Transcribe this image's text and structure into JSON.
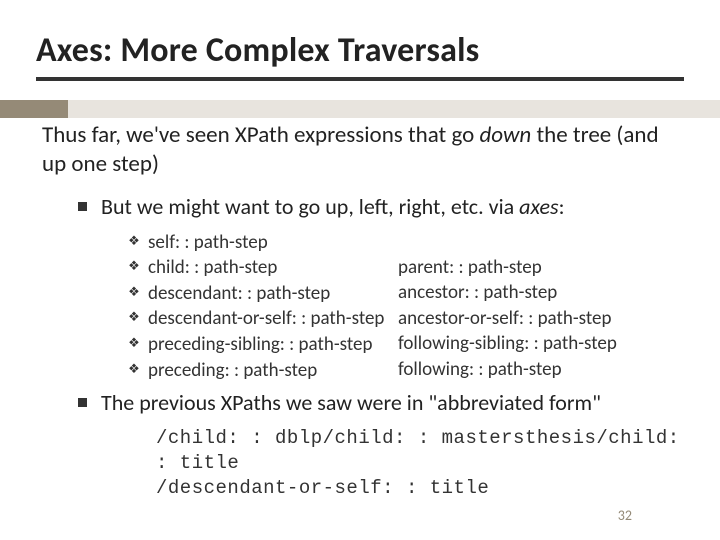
{
  "title": "Axes:  More Complex Traversals",
  "lead_a": "Thus far, we've seen XPath expressions that go ",
  "lead_down": "down",
  "lead_b": " the tree (and up one step)",
  "bullet1_a": "But we might want to go up, left, right, etc. via ",
  "bullet1_axes": "axes",
  "bullet1_b": ":",
  "axes_left": {
    "r1": "self: : path-step",
    "r2": "child: : path-step",
    "r3": "descendant: : path-step",
    "r4": "descendant-or-self: : path-step",
    "r5": "preceding-sibling: : path-step",
    "r6": "preceding: : path-step"
  },
  "axes_right": {
    "r1": "parent: : path-step",
    "r2": "ancestor: : path-step",
    "r3": "ancestor-or-self: : path-step",
    "r4": "following-sibling: : path-step",
    "r5": "following: : path-step"
  },
  "bullet2": "The previous XPaths we saw were in \"abbreviated form\"",
  "code1": "/child: : dblp/child: : mastersthesis/child: : title",
  "code2": "/descendant-or-self: : title",
  "pagenum": "32",
  "bullet_glyph": "❖"
}
